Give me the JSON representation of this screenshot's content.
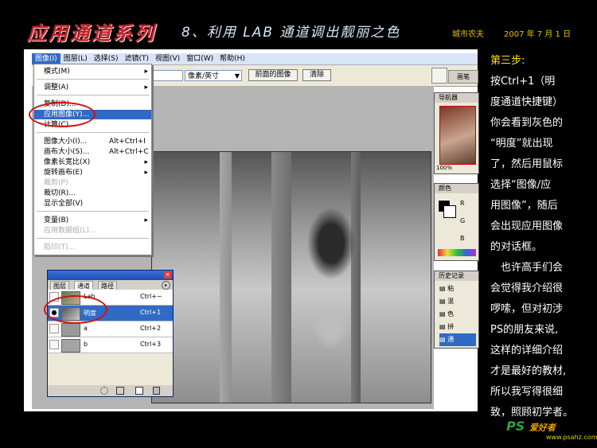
{
  "header": {
    "series_title": "应用通道系列",
    "lesson_title": "8、利用 LAB 通道调出靓丽之色",
    "author": "城市农夫",
    "date": "2007 年 7 月 1 日"
  },
  "menubar": {
    "items": [
      "图像(I)",
      "图层(L)",
      "选择(S)",
      "滤镜(T)",
      "视图(V)",
      "窗口(W)",
      "帮助(H)"
    ]
  },
  "options_bar": {
    "unit_select": "像素/英寸",
    "front_image_button": "前面的图像",
    "clear_button": "清除"
  },
  "image_menu": {
    "mode": "模式(M)",
    "adjust": "调整(A)",
    "duplicate": "复制(D)...",
    "apply_image": "应用图像(Y)...",
    "calculations": "计算(C)...",
    "image_size": "图像大小(I)...",
    "image_size_key": "Alt+Ctrl+I",
    "canvas_size": "画布大小(S)...",
    "canvas_size_key": "Alt+Ctrl+C",
    "pixel_aspect": "像素长宽比(X)",
    "rotate_canvas": "旋转画布(E)",
    "crop": "裁剪(P)",
    "trim": "裁切(R)...",
    "reveal_all": "显示全部(V)",
    "variables": "变量(B)",
    "apply_data_set": "应用数据组(L)...",
    "trap": "陷印(T)..."
  },
  "channels_panel": {
    "tabs": [
      "图层",
      "通道",
      "路径"
    ],
    "rows": [
      {
        "name": "Lab",
        "shortcut": "Ctrl+~"
      },
      {
        "name": "明度",
        "shortcut": "Ctrl+1"
      },
      {
        "name": "a",
        "shortcut": "Ctrl+2"
      },
      {
        "name": "b",
        "shortcut": "Ctrl+3"
      }
    ]
  },
  "right_panels": {
    "navigator": "导航器",
    "zoom": "100%",
    "color": "颜色",
    "channel_letters": [
      "R",
      "G",
      "B"
    ],
    "history": "历史记录",
    "history_items": [
      "粘",
      "混",
      "色",
      "拼",
      "通"
    ],
    "top_tab": "画笔"
  },
  "side_text": {
    "step": "第三步:",
    "lines": [
      "按Ctrl+1（明",
      "度通道快捷键）",
      "你会看到灰色的",
      "“明度”就出现",
      "了，然后用鼠标",
      "选择“图像/应",
      "用图像”，随后",
      "会出现应用图像",
      "的对话框。",
      "　也许高手们会",
      "会觉得我介绍很",
      "啰嗦，但对初涉",
      "PS的朋友来说,",
      "这样的详细介绍",
      "才是最好的教材,",
      "所以我写得很细",
      "致，照顾初学者。"
    ]
  },
  "watermark": {
    "logo": "PS",
    "site": "爱好者",
    "url": "www.psahz.com"
  },
  "colors": {
    "accent_red": "#c0242a",
    "highlight_blue": "#316ac5",
    "annotation_red": "#d01010"
  }
}
